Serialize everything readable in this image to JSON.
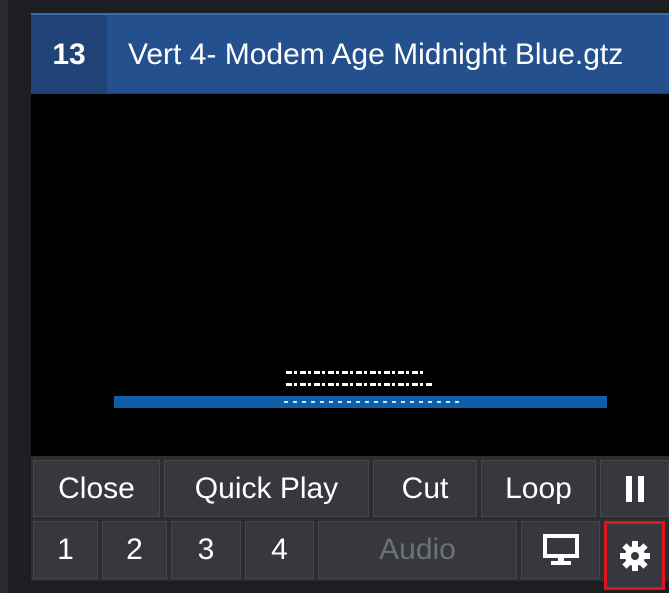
{
  "input": {
    "number": "13",
    "title": "Vert 4- Modem Age Midnight Blue.gtz"
  },
  "buttons_row1": {
    "close": "Close",
    "quick_play": "Quick Play",
    "cut": "Cut",
    "loop": "Loop",
    "pause_icon": "pause-icon"
  },
  "buttons_row2": {
    "out1": "1",
    "out2": "2",
    "out3": "3",
    "out4": "4",
    "audio": "Audio",
    "monitor_icon": "monitor-icon",
    "settings_icon": "gear-icon"
  },
  "colors": {
    "titlebar": "#24508e",
    "lower_third_bar": "#0e5fa8",
    "highlight": "#e0141d"
  }
}
